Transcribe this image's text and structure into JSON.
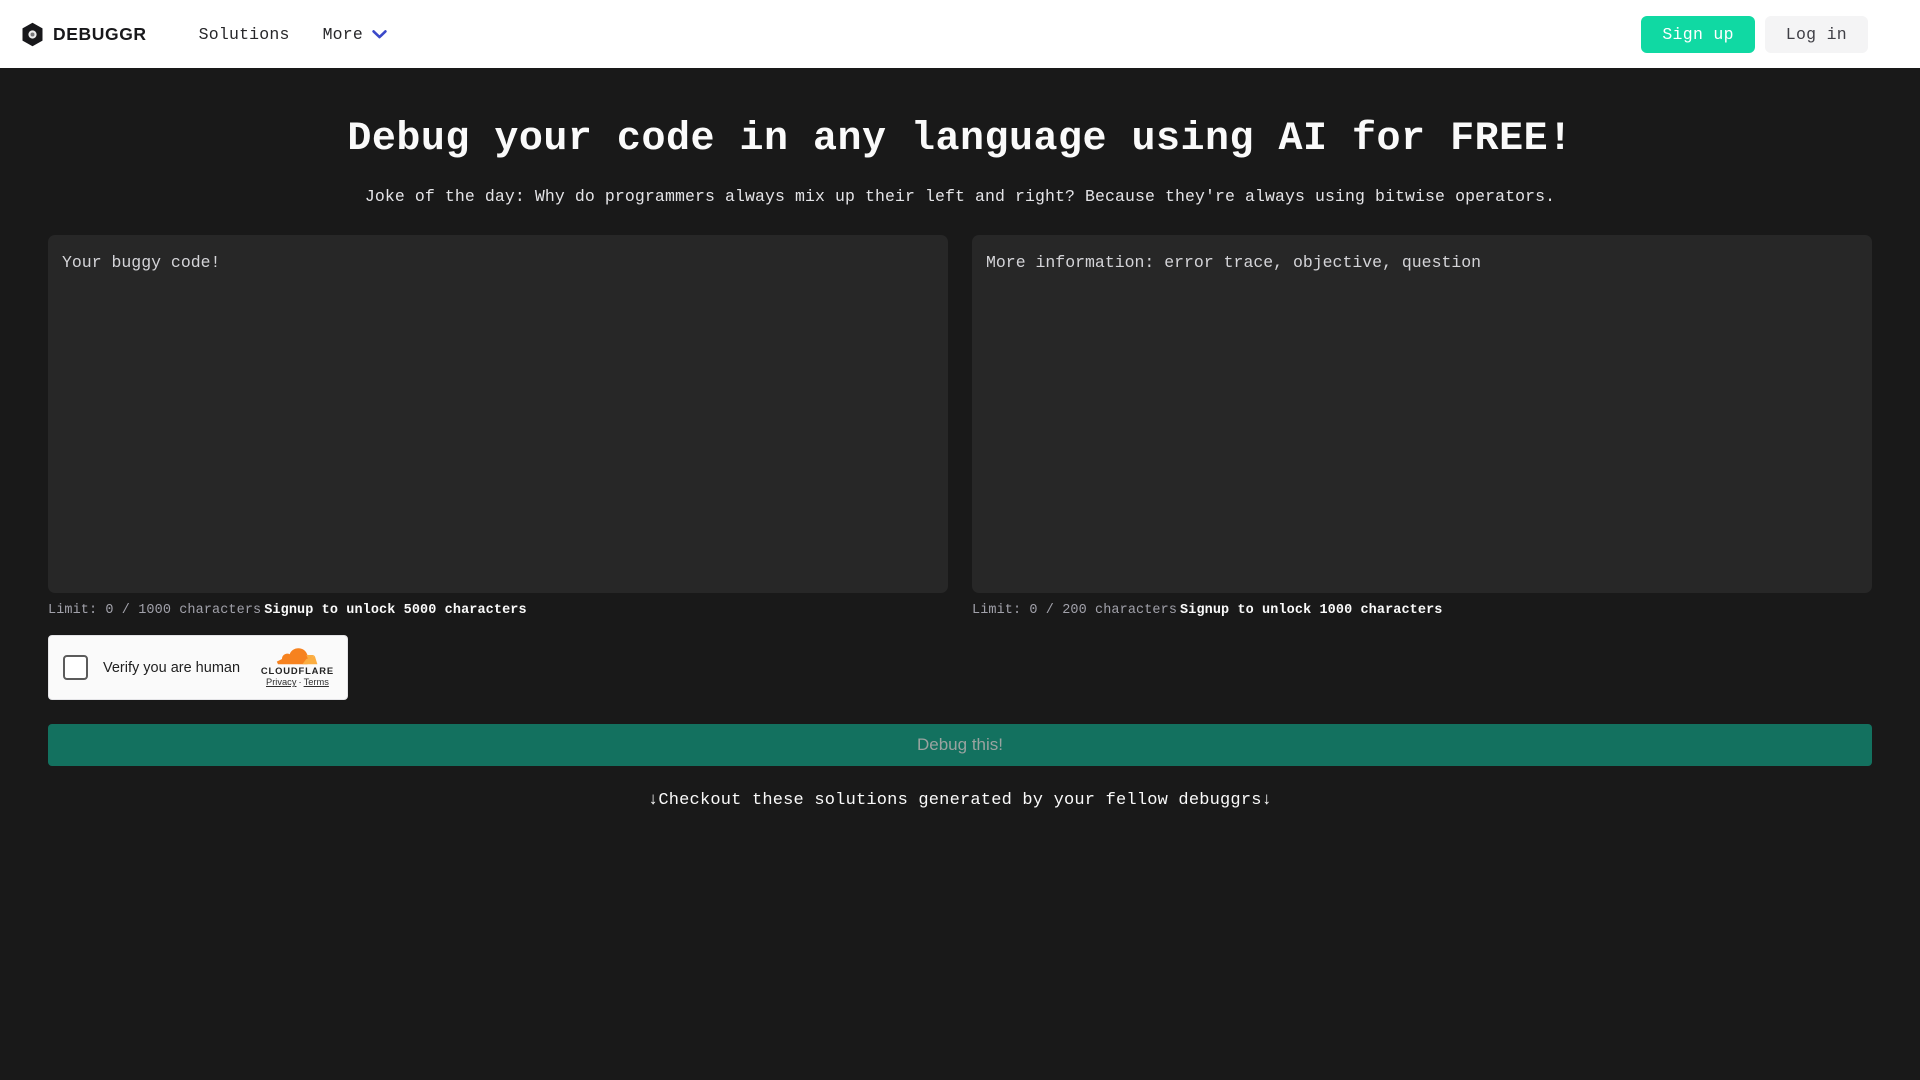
{
  "header": {
    "brand_name": "DEBUGGR",
    "brand_logo_icon": "hexagon-bug-logo-icon",
    "nav": [
      {
        "label": "Solutions",
        "name": "nav-solutions"
      },
      {
        "label": "More",
        "name": "nav-more",
        "icon": "chevron-down-icon"
      }
    ],
    "signup_label": "Sign up",
    "login_label": "Log in",
    "accent_color": "#10d9a3",
    "chevron_color": "#3b49c9",
    "background": "#ffffff"
  },
  "main": {
    "title": "Debug your code in any language using AI for FREE!",
    "joke": "Joke of the day: Why do programmers always mix up their left and right? Because they're always using bitwise operators.",
    "background": "#191919",
    "left_editor": {
      "placeholder": "Your buggy code!",
      "value": "",
      "limit_text": "Limit: 0 / 1000 characters",
      "unlock_text": "Signup to unlock 5000 characters",
      "used": 0,
      "max": 1000,
      "unlock_max": 5000
    },
    "right_editor": {
      "placeholder": "More information: error trace, objective, question",
      "value": "",
      "limit_text": "Limit: 0 / 200 characters",
      "unlock_text": "Signup to unlock 1000 characters",
      "used": 0,
      "max": 200,
      "unlock_max": 1000
    },
    "turnstile": {
      "checkbox_label": "Verify you are human",
      "checked": false,
      "brand": "CLOUDFLARE",
      "brand_icon": "cloudflare-cloud-icon",
      "privacy_label": "Privacy",
      "separator": "·",
      "terms_label": "Terms"
    },
    "debug_button": {
      "label": "Debug this!",
      "disabled": true,
      "color": "#13715f",
      "text_color": "#9aa3a0"
    },
    "footer_cta": "↓Checkout these solutions generated by your fellow debuggrs↓"
  }
}
